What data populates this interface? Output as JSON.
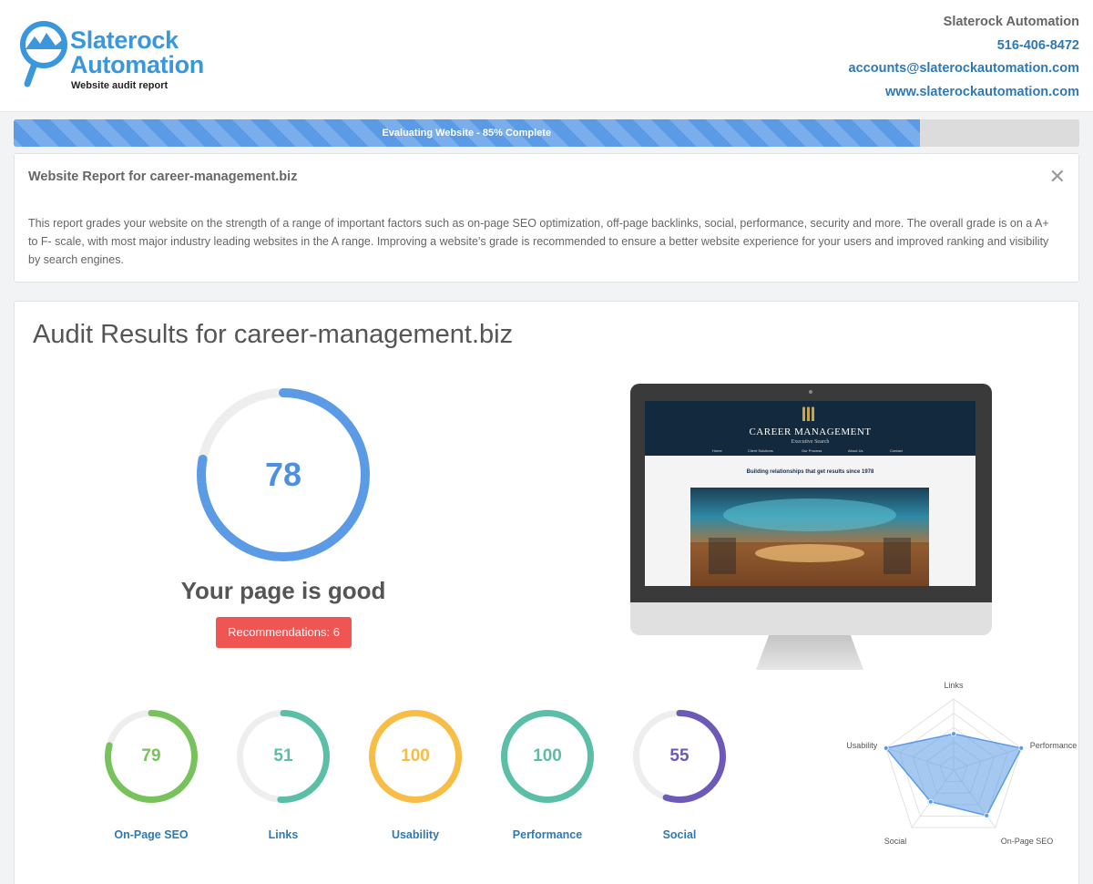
{
  "header": {
    "logo_line1": "Slaterock",
    "logo_line2": "Automation",
    "logo_sub": "Website audit report",
    "company": "Slaterock Automation",
    "phone": "516-406-8472",
    "email": "accounts@slaterockautomation.com",
    "website": "www.slaterockautomation.com"
  },
  "progress": {
    "label": "Evaluating Website - 85% Complete",
    "fraction": 0.85
  },
  "report": {
    "title": "Website Report for career-management.biz",
    "close": "✕",
    "body": "This report grades your website on the strength of a range of important factors such as on-page SEO optimization, off-page backlinks, social, performance, security and more. The overall grade is on a A+ to F- scale, with most major industry leading websites in the A range. Improving a website's grade is recommended to ensure a better website experience for your users and improved ranking and visibility by search engines."
  },
  "audit": {
    "title": "Audit Results for career-management.biz",
    "overall_score": 78,
    "overall_color": "#5b9be6",
    "verdict": "Your page is good",
    "recommendations": "Recommendations: 6"
  },
  "screenshot": {
    "site_title": "CAREER MANAGEMENT",
    "site_subtitle": "Executive Search",
    "nav": [
      "Home",
      "Client Solutions",
      "Our Process",
      "About Us",
      "Contact"
    ],
    "tagline": "Building relationships that get results since 1978"
  },
  "categories": [
    {
      "label": "On-Page SEO",
      "score": 79,
      "color": "#78c25c"
    },
    {
      "label": "Links",
      "score": 51,
      "color": "#5bbfa8"
    },
    {
      "label": "Usability",
      "score": 100,
      "color": "#f7bd45"
    },
    {
      "label": "Performance",
      "score": 100,
      "color": "#5bbfa8"
    },
    {
      "label": "Social",
      "score": 55,
      "color": "#6c59b8"
    }
  ],
  "radar": {
    "axes": [
      "Links",
      "Performance",
      "On-Page SEO",
      "Social",
      "Usability"
    ],
    "values": [
      51,
      100,
      79,
      55,
      100
    ],
    "fill": "#5b9be6"
  }
}
